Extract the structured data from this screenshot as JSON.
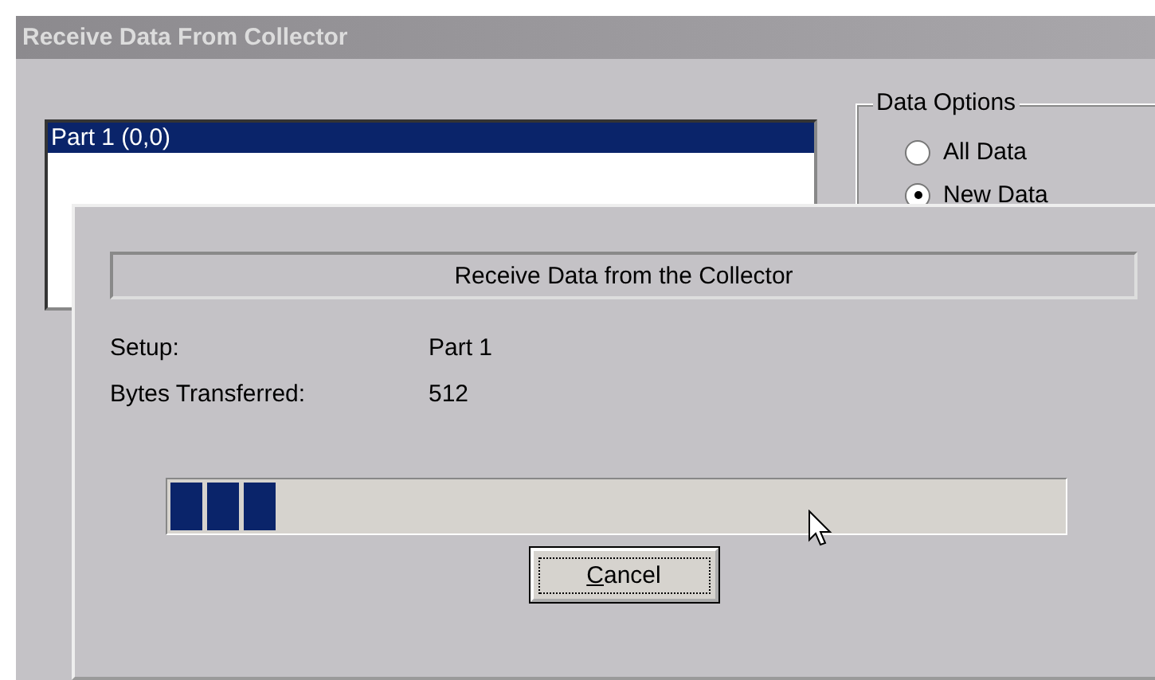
{
  "window": {
    "title": "Receive Data From Collector"
  },
  "list": {
    "items": [
      {
        "label": "Part 1 (0,0)",
        "selected": true
      }
    ]
  },
  "data_options": {
    "title": "Data Options",
    "options": [
      {
        "label": "All Data",
        "selected": false
      },
      {
        "label": "New Data",
        "selected": true
      }
    ]
  },
  "progress_dialog": {
    "heading": "Receive Data from the Collector",
    "fields": [
      {
        "label": "Setup:",
        "value": "Part 1"
      },
      {
        "label": "Bytes Transferred:",
        "value": "512"
      }
    ],
    "progress": {
      "level": 0.12
    },
    "buttons": [
      {
        "label": "Cancel"
      }
    ]
  }
}
